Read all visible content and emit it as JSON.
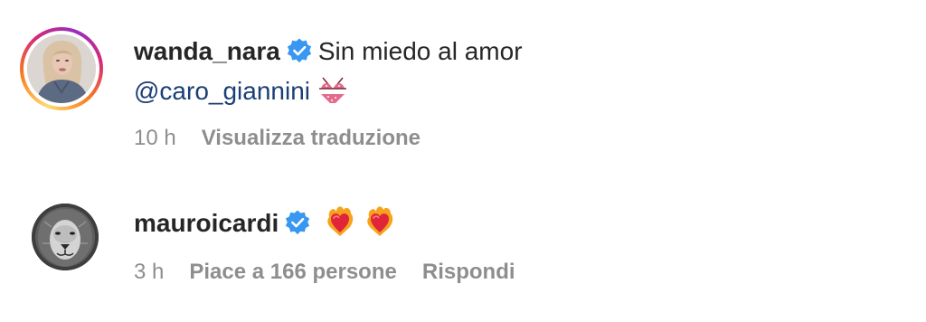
{
  "comments": [
    {
      "username": "wanda_nara",
      "verified": true,
      "text": "Sin miedo al amor",
      "mention": "@caro_giannini",
      "emoji": "bikini",
      "time": "10 h",
      "actions": [
        "Visualizza traduzione"
      ],
      "avatar": "woman-portrait",
      "story_ring": true
    },
    {
      "username": "mauroicardi",
      "verified": true,
      "emoji": [
        "heart-on-fire",
        "heart-on-fire"
      ],
      "time": "3 h",
      "actions": [
        "Piace a 166 persone",
        "Rispondi"
      ],
      "avatar": "lion-portrait-bw"
    }
  ],
  "colors": {
    "verified_badge": "#3897f0",
    "mention": "#1b3e77",
    "meta": "#8e8e8e",
    "text": "#262626"
  }
}
